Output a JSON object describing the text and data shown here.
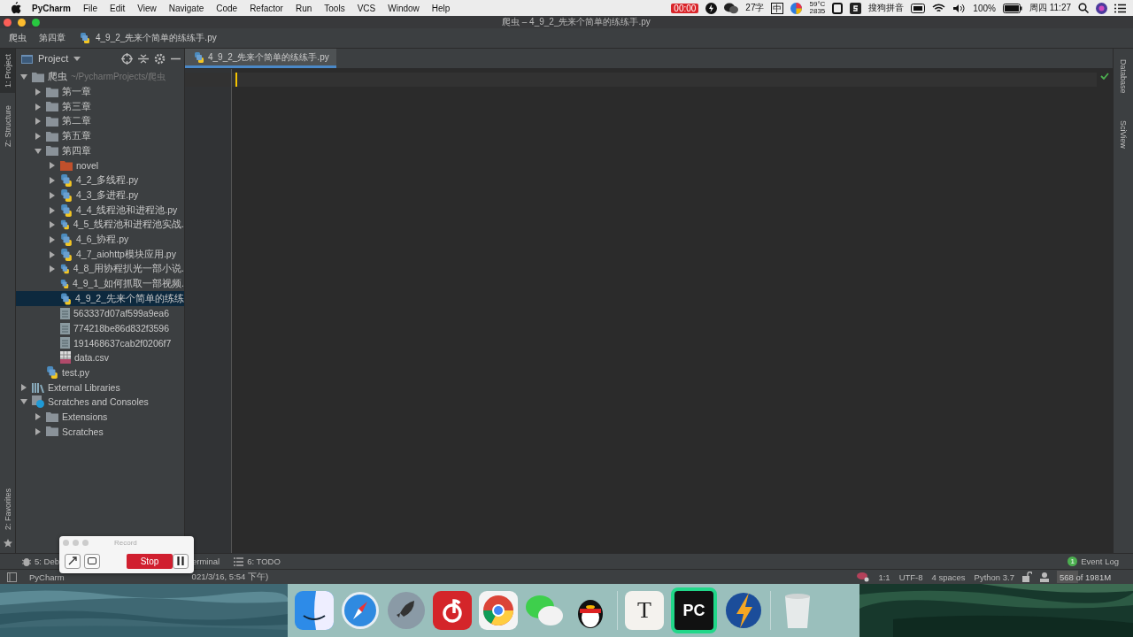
{
  "menu_bar": {
    "app": "PyCharm",
    "menus": [
      "File",
      "Edit",
      "View",
      "Navigate",
      "Code",
      "Refactor",
      "Run",
      "Tools",
      "VCS",
      "Window",
      "Help"
    ],
    "status": {
      "record_time": "00:00",
      "word_count": "27字",
      "input_mode": "中",
      "temperature": "59°C",
      "fan_speed": "2835",
      "input_method": "搜狗拼音",
      "battery": "100%",
      "clock": "周四 11:27"
    }
  },
  "window": {
    "title": "爬虫 – 4_9_2_先来个简单的练练手.py"
  },
  "breadcrumbs": [
    "爬虫",
    "第四章",
    "4_9_2_先来个简单的练练手.py"
  ],
  "left_stripe": [
    {
      "label": "1: Project",
      "selected": true
    },
    {
      "label": "Z: Structure",
      "selected": false
    }
  ],
  "favorites": {
    "label": "2: Favorites"
  },
  "project_panel": {
    "title": "Project",
    "tree": [
      {
        "name": "爬虫",
        "detail": "~/PycharmProjects/爬虫",
        "kind": "folder",
        "expanded": true,
        "selected": false,
        "children": [
          {
            "name": "第一章",
            "kind": "folder",
            "expanded": false,
            "selected": false
          },
          {
            "name": "第三章",
            "kind": "folder",
            "expanded": false,
            "selected": false
          },
          {
            "name": "第二章",
            "kind": "folder",
            "expanded": false,
            "selected": false
          },
          {
            "name": "第五章",
            "kind": "folder",
            "expanded": false,
            "selected": false
          },
          {
            "name": "第四章",
            "kind": "folder",
            "expanded": true,
            "selected": false,
            "children": [
              {
                "name": "novel",
                "kind": "excluded-folder",
                "expanded": false,
                "selected": false
              },
              {
                "name": "4_2_多线程.py",
                "kind": "python",
                "expanded": false,
                "selected": false
              },
              {
                "name": "4_3_多进程.py",
                "kind": "python",
                "expanded": false,
                "selected": false
              },
              {
                "name": "4_4_线程池和进程池.py",
                "kind": "python",
                "expanded": false,
                "selected": false
              },
              {
                "name": "4_5_线程池和进程池实战.",
                "kind": "python",
                "expanded": false,
                "selected": false
              },
              {
                "name": "4_6_协程.py",
                "kind": "python",
                "expanded": false,
                "selected": false
              },
              {
                "name": "4_7_aiohttp模块应用.py",
                "kind": "python",
                "expanded": false,
                "selected": false
              },
              {
                "name": "4_8_用协程扒光一部小说.",
                "kind": "python",
                "expanded": false,
                "selected": false
              },
              {
                "name": "4_9_1_如何抓取一部视频.",
                "kind": "python",
                "selected": false
              },
              {
                "name": "4_9_2_先来个简单的练练",
                "kind": "python",
                "selected": true
              },
              {
                "name": "563337d07af599a9ea6",
                "kind": "text",
                "selected": false
              },
              {
                "name": "774218be86d832f3596",
                "kind": "text",
                "selected": false
              },
              {
                "name": "191468637cab2f0206f7",
                "kind": "text",
                "selected": false
              },
              {
                "name": "data.csv",
                "kind": "csv",
                "selected": false
              }
            ]
          },
          {
            "name": "test.py",
            "kind": "python",
            "selected": false
          }
        ]
      },
      {
        "name": "External Libraries",
        "kind": "libraries",
        "expanded": false,
        "selected": false
      },
      {
        "name": "Scratches and Consoles",
        "kind": "scratches",
        "expanded": true,
        "selected": false,
        "children": [
          {
            "name": "Extensions",
            "kind": "folder",
            "expanded": false,
            "selected": false
          },
          {
            "name": "Scratches",
            "kind": "folder",
            "expanded": false,
            "selected": false
          }
        ]
      }
    ]
  },
  "editor": {
    "tabs": [
      {
        "label": "4_9_2_先来个简单的练练手.py",
        "selected": true
      }
    ]
  },
  "right_stripe": [
    {
      "label": "Database"
    },
    {
      "label": "SciView"
    }
  ],
  "tool_buttons": [
    {
      "kind": "debug",
      "label": "5: Deb"
    },
    {
      "kind": "plain",
      "label": "erminal"
    },
    {
      "kind": "todo",
      "label": "6: TODO"
    }
  ],
  "event_log": {
    "badge": "1",
    "label": "Event Log"
  },
  "status_bar": {
    "message_start": "PyCharm",
    "message_end": "021/3/16, 5:54 下午)",
    "position": "1:1",
    "encoding": "UTF-8",
    "indent": "4 spaces",
    "interpreter": "Python 3.7",
    "memory": "568 of 1981M",
    "level": 0.31
  },
  "record_window": {
    "title": "Record",
    "stop": "Stop"
  },
  "dock": [
    {
      "kind": "finder"
    },
    {
      "kind": "safari"
    },
    {
      "kind": "launchpad"
    },
    {
      "kind": "music"
    },
    {
      "kind": "chrome"
    },
    {
      "kind": "wechat"
    },
    {
      "kind": "qq"
    },
    {
      "kind": "separator"
    },
    {
      "kind": "typora",
      "glyph": "T"
    },
    {
      "kind": "pycharm",
      "glyph": "PC"
    },
    {
      "kind": "bolt"
    },
    {
      "kind": "separator"
    },
    {
      "kind": "trash"
    }
  ]
}
